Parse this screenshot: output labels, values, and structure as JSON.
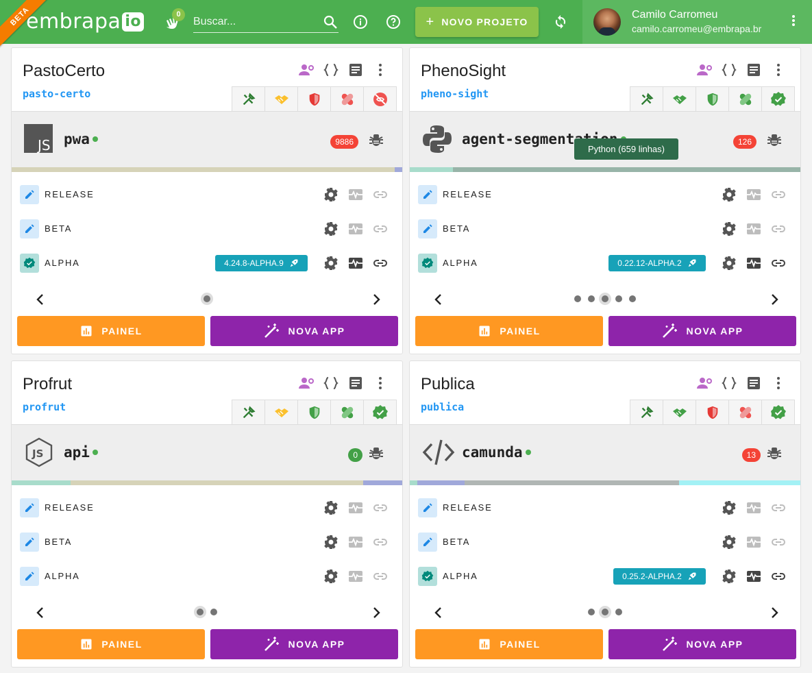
{
  "header": {
    "ribbon": "BETA",
    "logo_text": "embrapa",
    "logo_suffix": "io",
    "notifications_count": "0",
    "search_placeholder": "Buscar...",
    "new_project_label": "NOVO PROJETO",
    "user_name": "Camilo Carromeu",
    "user_email": "camilo.carromeu@embrapa.br"
  },
  "colors": {
    "topbar": "#4caf50",
    "painel": "#ff9822",
    "nova_app": "#8e24aa",
    "version": "#17a2b8",
    "slug": "#2196f3"
  },
  "tooltip": "Python (659 linhas)",
  "projects": [
    {
      "title": "PastoCerto",
      "slug": "pasto-certo",
      "tabs": [
        "tools-icon",
        "handshake-icon",
        "shield-red-icon",
        "bandage-red-icon",
        "eye-off-red-icon"
      ],
      "app": {
        "name": "pwa",
        "logo": "js-square-icon",
        "issues": "9886",
        "issues_color": "#f44336"
      },
      "envs": [
        {
          "label": "RELEASE",
          "status": "edit",
          "version": ""
        },
        {
          "label": "BETA",
          "status": "edit",
          "version": ""
        },
        {
          "label": "ALPHA",
          "status": "ok",
          "version": "4.24.8-ALPHA.9"
        }
      ],
      "dots": 1,
      "active_dot": 0,
      "painel_label": "PAINEL",
      "nova_label": "NOVA APP"
    },
    {
      "title": "PhenoSight",
      "slug": "pheno-sight",
      "tabs": [
        "tools-icon",
        "handshake-green-icon",
        "shield-green-icon",
        "bandage-green-icon",
        "verified-green-icon"
      ],
      "app": {
        "name": "agent-segmentation",
        "logo": "python-icon",
        "issues": "126",
        "issues_color": "#f44336"
      },
      "envs": [
        {
          "label": "RELEASE",
          "status": "edit",
          "version": ""
        },
        {
          "label": "BETA",
          "status": "edit",
          "version": ""
        },
        {
          "label": "ALPHA",
          "status": "ok",
          "version": "0.22.12-ALPHA.2"
        }
      ],
      "dots": 5,
      "active_dot": 2,
      "painel_label": "PAINEL",
      "nova_label": "NOVA APP"
    },
    {
      "title": "Profrut",
      "slug": "profrut",
      "tabs": [
        "tools-icon",
        "handshake-icon",
        "shield-green-icon",
        "bandage-green-icon",
        "verified-green-icon"
      ],
      "app": {
        "name": "api",
        "logo": "nodejs-icon",
        "issues": "0",
        "issues_color": "#43a047"
      },
      "envs": [
        {
          "label": "RELEASE",
          "status": "edit",
          "version": ""
        },
        {
          "label": "BETA",
          "status": "edit",
          "version": ""
        },
        {
          "label": "ALPHA",
          "status": "edit",
          "version": ""
        }
      ],
      "dots": 2,
      "active_dot": 0,
      "painel_label": "PAINEL",
      "nova_label": "NOVA APP"
    },
    {
      "title": "Publica",
      "slug": "publica",
      "tabs": [
        "tools-icon",
        "handshake-green-icon",
        "shield-red-icon",
        "bandage-red-icon",
        "verified-green-icon"
      ],
      "app": {
        "name": "camunda",
        "logo": "code-icon",
        "issues": "13",
        "issues_color": "#f44336"
      },
      "envs": [
        {
          "label": "RELEASE",
          "status": "edit",
          "version": ""
        },
        {
          "label": "BETA",
          "status": "edit",
          "version": ""
        },
        {
          "label": "ALPHA",
          "status": "ok",
          "version": "0.25.2-ALPHA.2"
        }
      ],
      "dots": 3,
      "active_dot": 1,
      "painel_label": "PAINEL",
      "nova_label": "NOVA APP"
    }
  ]
}
